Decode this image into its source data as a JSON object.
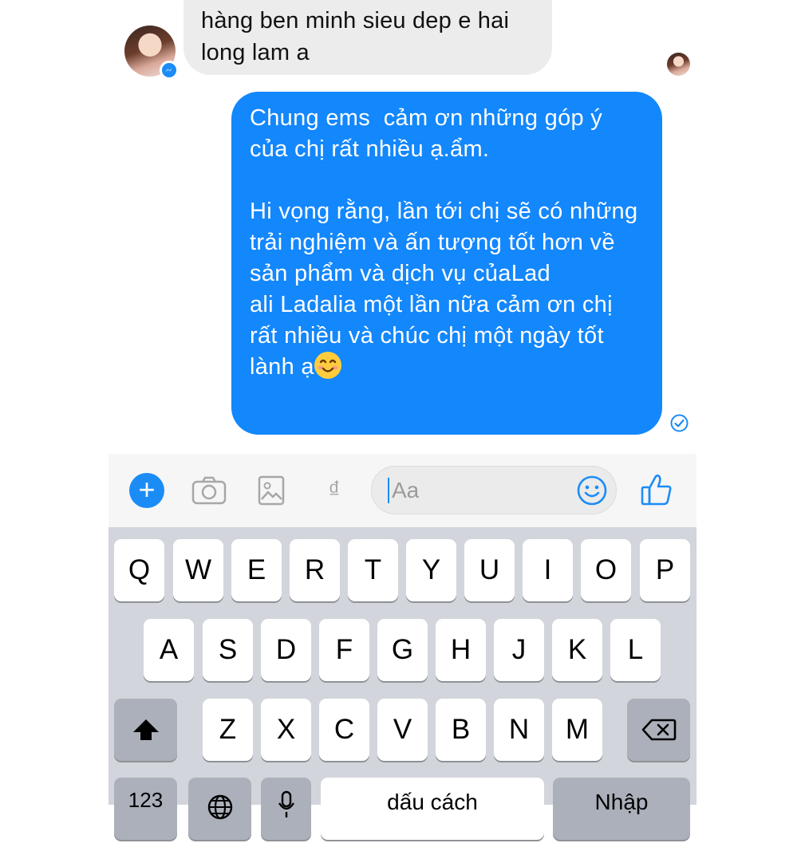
{
  "conversation": {
    "incoming_message": "hàng ben minh sieu dep e hai long lam a",
    "outgoing_paragraphs": [
      "Chung ems  cảm ơn những góp ý của chị rất nhiều ạ.ẩm.",
      "Hi vọng rằng, lần tới chị sẽ có những trải nghiệm và ấn tượng tốt hơn về sản phẩm và dịch vụ củaLad\nali Ladalia một lần nữa cảm ơn chị rất nhiều và chúc chị một ngày tốt lành ạ"
    ],
    "emoji": "smiling-face-emoji",
    "brand_color": "#1387fc",
    "incoming_bubble_color": "#ececec"
  },
  "composer": {
    "placeholder": "Aa",
    "currency_symbol": "₫",
    "icons": [
      "plus-icon",
      "camera-icon",
      "image-icon",
      "payment-icon",
      "emoji-icon",
      "thumbs-up-icon"
    ]
  },
  "keyboard": {
    "row1": [
      "Q",
      "W",
      "E",
      "R",
      "T",
      "Y",
      "U",
      "I",
      "O",
      "P"
    ],
    "row2": [
      "A",
      "S",
      "D",
      "F",
      "G",
      "H",
      "J",
      "K",
      "L"
    ],
    "row3": [
      "Z",
      "X",
      "C",
      "V",
      "B",
      "N",
      "M"
    ],
    "bottom": {
      "numbers": "123",
      "space": "dấu cách",
      "return": "Nhập"
    }
  }
}
